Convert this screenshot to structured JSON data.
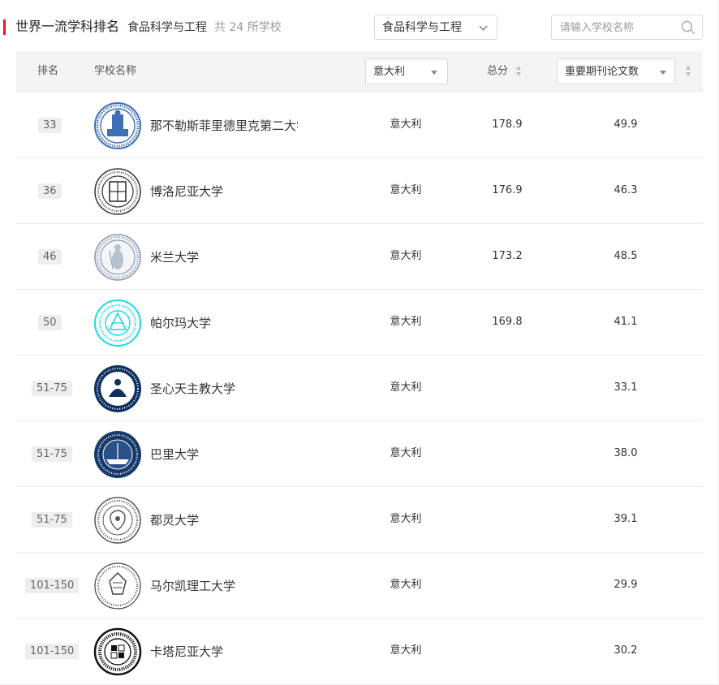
{
  "header": {
    "title": "世界一流学科排名",
    "subject": "食品科学与工程",
    "count_text": "共 24 所学校",
    "subject_select_value": "食品科学与工程",
    "search_placeholder": "请输入学校名称"
  },
  "colors": {
    "accent": "#e0162b",
    "header_bg": "#f4f4f4",
    "badge_bg": "#eeeeee"
  },
  "table": {
    "col_rank": "排名",
    "col_name": "学校名称",
    "country_filter": "意大利",
    "col_score": "总分",
    "metric_filter": "重要期刊论文数",
    "rows": [
      {
        "rank": "33",
        "name": "那不勒斯菲里德里克第二大学",
        "country": "意大利",
        "score": "178.9",
        "metric": "49.9",
        "logo_color": "#3d6fb6"
      },
      {
        "rank": "36",
        "name": "博洛尼亚大学",
        "country": "意大利",
        "score": "176.9",
        "metric": "46.3",
        "logo_color": "#333333"
      },
      {
        "rank": "46",
        "name": "米兰大学",
        "country": "意大利",
        "score": "173.2",
        "metric": "48.5",
        "logo_color": "#8e9ab0"
      },
      {
        "rank": "50",
        "name": "帕尔玛大学",
        "country": "意大利",
        "score": "169.8",
        "metric": "41.1",
        "logo_color": "#1ad9e6"
      },
      {
        "rank": "51-75",
        "name": "圣心天主教大学",
        "country": "意大利",
        "score": "",
        "metric": "33.1",
        "logo_color": "#0d2f5f"
      },
      {
        "rank": "51-75",
        "name": "巴里大学",
        "country": "意大利",
        "score": "",
        "metric": "38.0",
        "logo_color": "#173a6b"
      },
      {
        "rank": "51-75",
        "name": "都灵大学",
        "country": "意大利",
        "score": "",
        "metric": "39.1",
        "logo_color": "#555555"
      },
      {
        "rank": "101-150",
        "name": "马尔凯理工大学",
        "country": "意大利",
        "score": "",
        "metric": "29.9",
        "logo_color": "#444444"
      },
      {
        "rank": "101-150",
        "name": "卡塔尼亚大学",
        "country": "意大利",
        "score": "",
        "metric": "30.2",
        "logo_color": "#111111"
      }
    ]
  }
}
